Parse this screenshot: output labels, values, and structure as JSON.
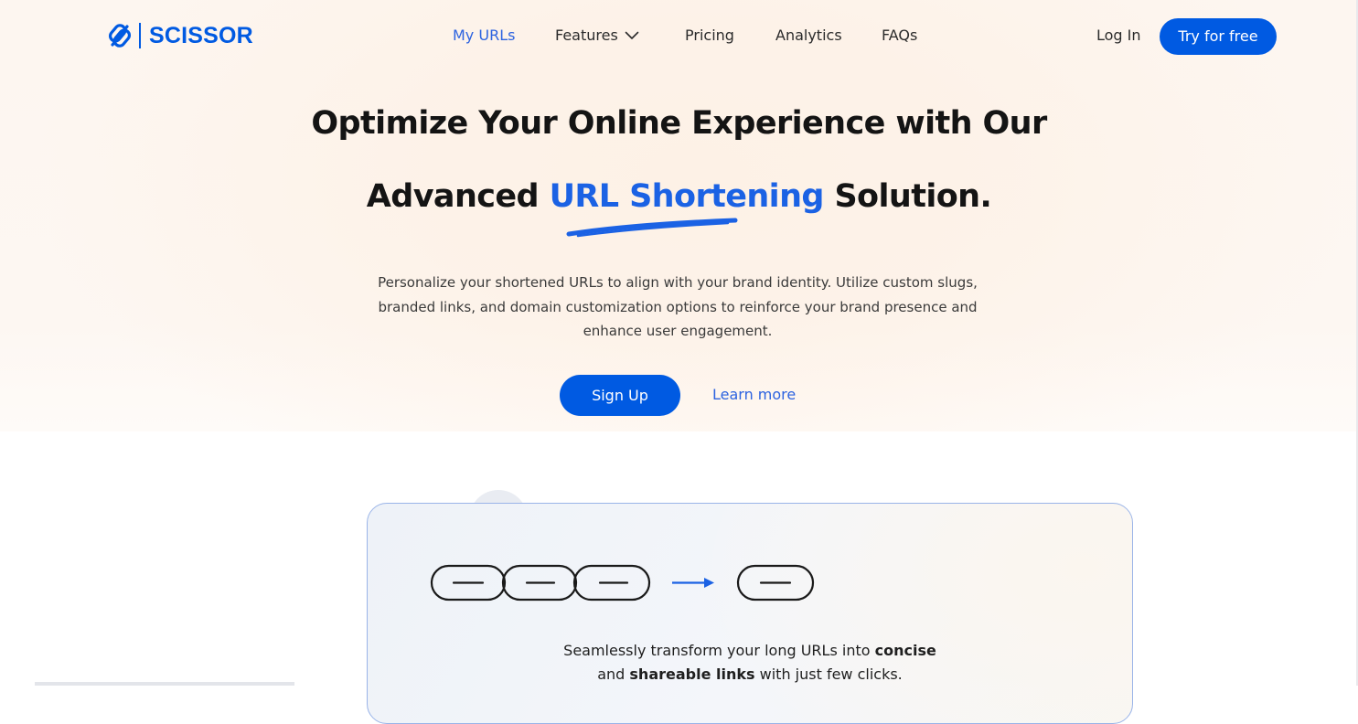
{
  "brand": {
    "name": "SCISSOR",
    "color": "#005ae2"
  },
  "nav": {
    "items": [
      {
        "label": "My URLs",
        "active": true
      },
      {
        "label": "Features",
        "has_dropdown": true
      },
      {
        "label": "Pricing"
      },
      {
        "label": "Analytics"
      },
      {
        "label": "FAQs"
      }
    ],
    "login_label": "Log In",
    "cta_label": "Try for free"
  },
  "hero": {
    "headline_line1": "Optimize Your Online Experience with Our",
    "headline_line2_prefix": "Advanced ",
    "headline_line2_accent": "URL Shortening",
    "headline_line2_suffix": " Solution.",
    "description": "Personalize your shortened URLs to align with your brand identity. Utilize custom slugs, branded links, and domain customization options to reinforce your brand presence and enhance user engagement.",
    "primary_button": "Sign Up",
    "secondary_link": "Learn more"
  },
  "feature_card": {
    "text_part1": "Seamlessly transform your long URLs into ",
    "text_bold1": "concise",
    "text_part2": "and ",
    "text_bold2": "shareable links",
    "text_part3": " with just few clicks."
  },
  "colors": {
    "accent": "#005ae2",
    "link": "#2d63e0",
    "hero_background": "#fdf6f0",
    "card_border": "#9ab4e8"
  },
  "icons": {
    "logo": "link-icon",
    "features_dropdown": "chevron-down-icon",
    "illustration": "long-chain-to-short-chain"
  }
}
